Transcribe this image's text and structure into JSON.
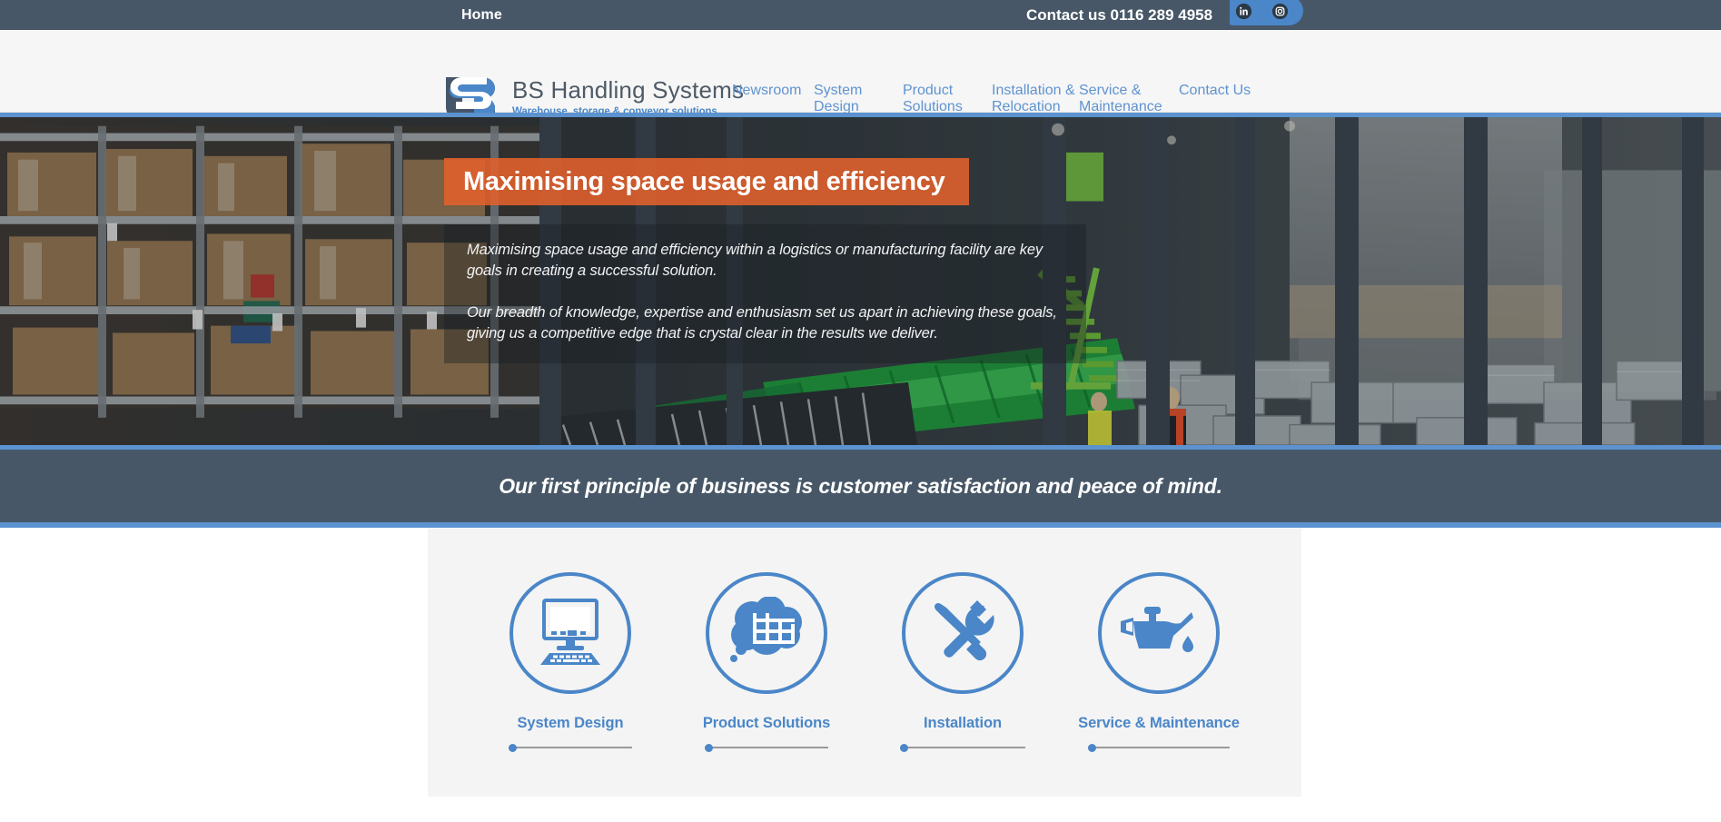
{
  "topbar": {
    "home_label": "Home",
    "contact_text": "Contact us 0116 289 4958",
    "social": [
      {
        "name": "linkedin-icon",
        "glyph": "in"
      },
      {
        "name": "instagram-icon",
        "glyph": ""
      }
    ]
  },
  "header": {
    "brand_name": "BS Handling Systems",
    "brand_tagline": "Warehouse, storage & conveyor solutions",
    "logo_alt": "BS monogram logo",
    "nav": [
      {
        "label": "Newsroom"
      },
      {
        "label": "System\nDesign"
      },
      {
        "label": "Product\nSolutions"
      },
      {
        "label": "Installation &\nRelocation"
      },
      {
        "label": "Service &\nMaintenance"
      },
      {
        "label": "Contact Us"
      }
    ]
  },
  "hero": {
    "title": "Maximising space usage and efficiency",
    "paragraph_1": "Maximising space usage and efficiency within a logistics or manufacturing facility are key goals in creating a successful solution.",
    "paragraph_2": "Our breadth of knowledge, expertise and enthusiasm set us apart in achieving these goals, giving us a competitive edge that is crystal clear in the results we deliver.",
    "image_description": "Warehouse aisle with pallet racking, cardboard cartons, conveyor lines, green steel staircase and two workers in hi-vis"
  },
  "tagline": {
    "text": "Our first principle of business is customer satisfaction and peace of mind."
  },
  "services": [
    {
      "label": "System Design",
      "icon": "monitor-keyboard-icon"
    },
    {
      "label": "Product Solutions",
      "icon": "thought-bubble-racking-icon"
    },
    {
      "label": "Installation",
      "icon": "wrench-screwdriver-icon"
    },
    {
      "label": "Service & Maintenance",
      "icon": "oil-can-icon"
    }
  ],
  "colors": {
    "dark_slate": "#475767",
    "brand_blue": "#4a86c8",
    "accent_blue_border": "#5b92cf",
    "orange_banner": "#e2612c",
    "panel_grey": "#f4f4f4",
    "header_grey": "#f6f6f6",
    "nav_link": "#5f93d0"
  }
}
